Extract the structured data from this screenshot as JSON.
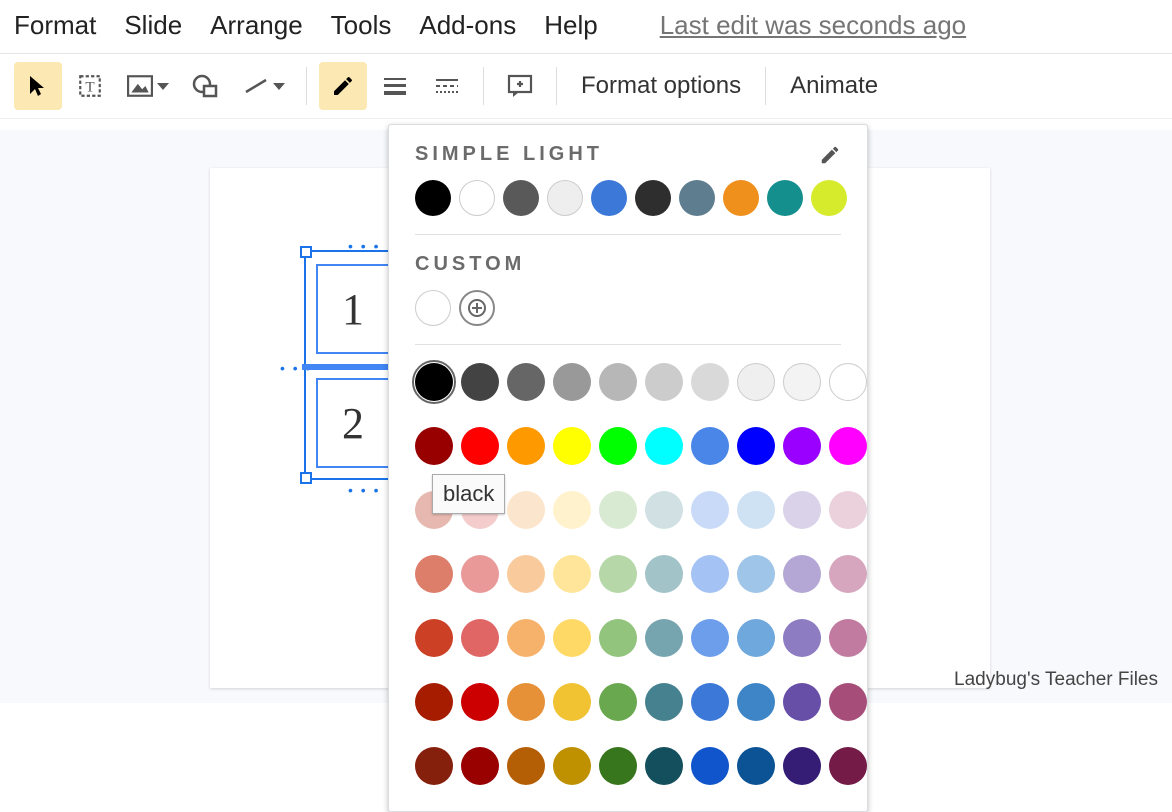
{
  "menu": {
    "format": "Format",
    "slide": "Slide",
    "arrange": "Arrange",
    "tools": "Tools",
    "addons": "Add-ons",
    "help": "Help",
    "edit_status": "Last edit was seconds ago"
  },
  "toolbar": {
    "format_options": "Format options",
    "animate": "Animate"
  },
  "cells": {
    "c1": "1",
    "c2": "2"
  },
  "panel": {
    "theme_title": "SIMPLE LIGHT",
    "custom_title": "CUSTOM",
    "tooltip": "black",
    "theme_colors": [
      "#000000",
      "#ffffff",
      "#595959",
      "#eeeeee",
      "#3c78d8",
      "#2e2e2e",
      "#5e7d8f",
      "#ef8f1c",
      "#148f8e",
      "#d5eb2b"
    ],
    "custom_colors": [
      "#ffffff"
    ],
    "gray_row": [
      "#000000",
      "#434343",
      "#666666",
      "#999999",
      "#b7b7b7",
      "#cccccc",
      "#d9d9d9",
      "#efefef",
      "#f3f3f3",
      "#ffffff"
    ],
    "primary_row": [
      "#980000",
      "#ff0000",
      "#ff9900",
      "#ffff00",
      "#00ff00",
      "#00ffff",
      "#4a86e8",
      "#0000ff",
      "#9900ff",
      "#ff00ff"
    ],
    "shade_rows": [
      [
        "#e6b8af",
        "#f4cccc",
        "#fce5cd",
        "#fff2cc",
        "#d9ead3",
        "#d0e0e3",
        "#c9daf8",
        "#cfe2f3",
        "#d9d2e9",
        "#ead1dc"
      ],
      [
        "#dd7e6b",
        "#ea9999",
        "#f9cb9c",
        "#ffe599",
        "#b6d7a8",
        "#a2c4c9",
        "#a4c2f4",
        "#9fc5e8",
        "#b4a7d6",
        "#d5a6bd"
      ],
      [
        "#cc4125",
        "#e06666",
        "#f6b26b",
        "#ffd966",
        "#93c47d",
        "#76a5af",
        "#6d9eeb",
        "#6fa8dc",
        "#8e7cc3",
        "#c27ba0"
      ],
      [
        "#a61c00",
        "#cc0000",
        "#e69138",
        "#f1c232",
        "#6aa84f",
        "#45818e",
        "#3c78d8",
        "#3d85c6",
        "#674ea7",
        "#a64d79"
      ],
      [
        "#85200c",
        "#990000",
        "#b45f06",
        "#bf9000",
        "#38761d",
        "#134f5c",
        "#1155cc",
        "#0b5394",
        "#351c75",
        "#741b47"
      ]
    ]
  },
  "watermark": "Ladybug's Teacher Files"
}
